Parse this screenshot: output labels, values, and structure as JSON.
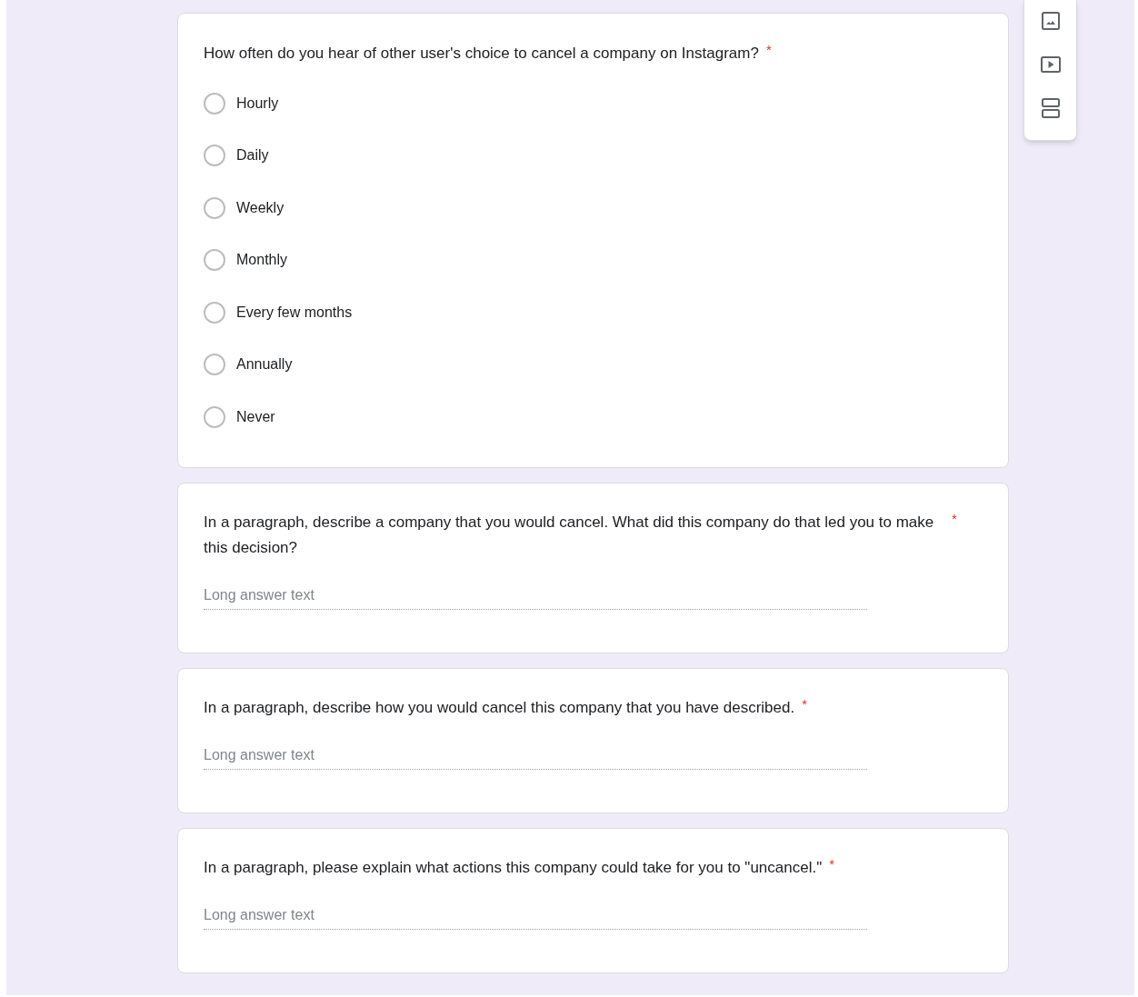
{
  "questions": [
    {
      "kind": "choice",
      "title": "How often do you hear of other user's choice to cancel a company on Instagram?",
      "required_mark": "*",
      "options": [
        {
          "label": "Hourly",
          "selected": false
        },
        {
          "label": "Daily",
          "selected": false
        },
        {
          "label": "Weekly",
          "selected": false
        },
        {
          "label": "Monthly",
          "selected": false
        },
        {
          "label": "Every few months",
          "selected": false
        },
        {
          "label": "Annually",
          "selected": false
        },
        {
          "label": "Never",
          "selected": false
        }
      ]
    },
    {
      "kind": "paragraph",
      "title": "In a paragraph, describe a company that you would cancel. What did this company do that led you to make this decision?",
      "required_mark": "*",
      "placeholder": "Long answer text"
    },
    {
      "kind": "paragraph",
      "title": "In a paragraph, describe how you would cancel this company that you have described.",
      "required_mark": "*",
      "placeholder": "Long answer text"
    },
    {
      "kind": "paragraph",
      "title": "In a paragraph, please explain what actions this company could take for you to \"uncancel.\"",
      "required_mark": "*",
      "placeholder": "Long answer text"
    }
  ],
  "toolbar": [
    {
      "kind": "image"
    },
    {
      "kind": "video"
    },
    {
      "kind": "section"
    }
  ]
}
